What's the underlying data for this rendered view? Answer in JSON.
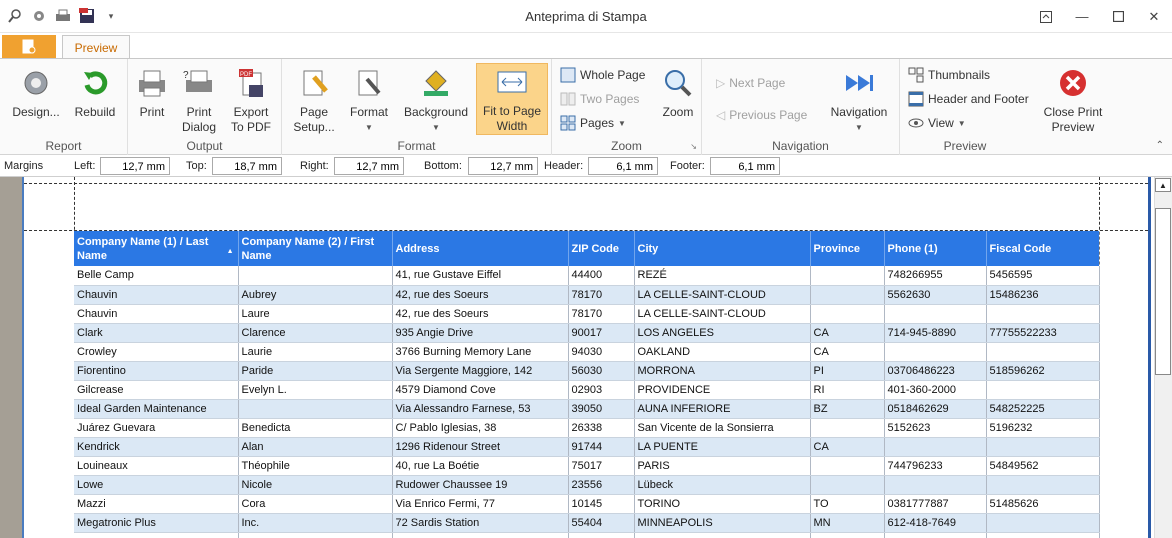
{
  "window": {
    "title": "Anteprima di Stampa"
  },
  "tabs": {
    "file_icon": "file-menu-icon",
    "preview": "Preview"
  },
  "ribbon": {
    "report": {
      "label": "Report",
      "design": "Design...",
      "rebuild": "Rebuild"
    },
    "output": {
      "label": "Output",
      "print": "Print",
      "print_dialog_1": "Print",
      "print_dialog_2": "Dialog",
      "export_1": "Export",
      "export_2": "To PDF"
    },
    "format": {
      "label": "Format",
      "page_setup_1": "Page",
      "page_setup_2": "Setup...",
      "format": "Format",
      "background": "Background",
      "fit_1": "Fit to Page",
      "fit_2": "Width"
    },
    "zoom": {
      "label": "Zoom",
      "whole_page": "Whole Page",
      "two_pages": "Two Pages",
      "pages": "Pages",
      "zoom": "Zoom"
    },
    "navigation": {
      "label": "Navigation",
      "next_page": "Next Page",
      "previous_page": "Previous Page",
      "navigation": "Navigation"
    },
    "preview": {
      "label": "Preview",
      "thumbnails": "Thumbnails",
      "header_footer": "Header and Footer",
      "view": "View",
      "close_1": "Close Print",
      "close_2": "Preview"
    }
  },
  "margins": {
    "title": "Margins",
    "left_label": "Left:",
    "left": "12,7 mm",
    "top_label": "Top:",
    "top": "18,7 mm",
    "right_label": "Right:",
    "right": "12,7 mm",
    "bottom_label": "Bottom:",
    "bottom": "12,7 mm",
    "header_label": "Header:",
    "header": "6,1 mm",
    "footer_label": "Footer:",
    "footer": "6,1 mm"
  },
  "table": {
    "columns": [
      "Company Name (1) / Last Name",
      "Company Name (2) / First Name",
      "Address",
      "ZIP Code",
      "City",
      "Province",
      "Phone (1)",
      "Fiscal Code"
    ],
    "rows": [
      [
        "Belle Camp",
        "",
        "41, rue Gustave Eiffel",
        "44400",
        "REZÉ",
        "",
        "748266955",
        "5456595"
      ],
      [
        "Chauvin",
        "Aubrey",
        "42, rue des Soeurs",
        "78170",
        "LA CELLE-SAINT-CLOUD",
        "",
        "5562630",
        "15486236"
      ],
      [
        "Chauvin",
        "Laure",
        "42, rue des Soeurs",
        "78170",
        "LA CELLE-SAINT-CLOUD",
        "",
        "",
        ""
      ],
      [
        "Clark",
        "Clarence",
        "935 Angie Drive",
        "90017",
        "LOS ANGELES",
        "CA",
        "714-945-8890",
        "77755522233"
      ],
      [
        "Crowley",
        "Laurie",
        "3766 Burning Memory Lane",
        "94030",
        "OAKLAND",
        "CA",
        "",
        ""
      ],
      [
        "Fiorentino",
        "Paride",
        "Via Sergente Maggiore, 142",
        "56030",
        "MORRONA",
        "PI",
        "03706486223",
        "518596262"
      ],
      [
        "Gilcrease",
        "Evelyn L.",
        "4579 Diamond Cove",
        "02903",
        "PROVIDENCE",
        "RI",
        "401-360-2000",
        ""
      ],
      [
        "Ideal Garden Maintenance",
        "",
        "Via Alessandro Farnese, 53",
        "39050",
        "AUNA INFERIORE",
        "BZ",
        "0518462629",
        "548252225"
      ],
      [
        "Juárez Guevara",
        "Benedicta",
        "C/ Pablo Iglesias, 38",
        "26338",
        "San Vicente de la Sonsierra",
        "",
        "5152623",
        "5196232"
      ],
      [
        "Kendrick",
        "Alan",
        "1296 Ridenour Street",
        "91744",
        "LA PUENTE",
        "CA",
        "",
        ""
      ],
      [
        "Louineaux",
        "Théophile",
        "40, rue La Boétie",
        "75017",
        "PARIS",
        "",
        "744796233",
        "54849562"
      ],
      [
        "Lowe",
        "Nicole",
        "Rudower Chaussee 19",
        "23556",
        "Lübeck",
        "",
        "",
        ""
      ],
      [
        "Mazzi",
        "Cora",
        "Via Enrico Fermi, 77",
        "10145",
        "TORINO",
        "TO",
        "0381777887",
        "51485626"
      ],
      [
        "Megatronic Plus",
        "Inc.",
        "72 Sardis Station",
        "55404",
        "MINNEAPOLIS",
        "MN",
        "612-418-7649",
        ""
      ],
      [
        "",
        "",
        "",
        "",
        "",
        "",
        "",
        ""
      ]
    ]
  },
  "colors": {
    "accent": "#2b78e4",
    "alt_row": "#dbe8f5",
    "file_tab": "#f0a130",
    "active_button": "#fbd48a"
  }
}
